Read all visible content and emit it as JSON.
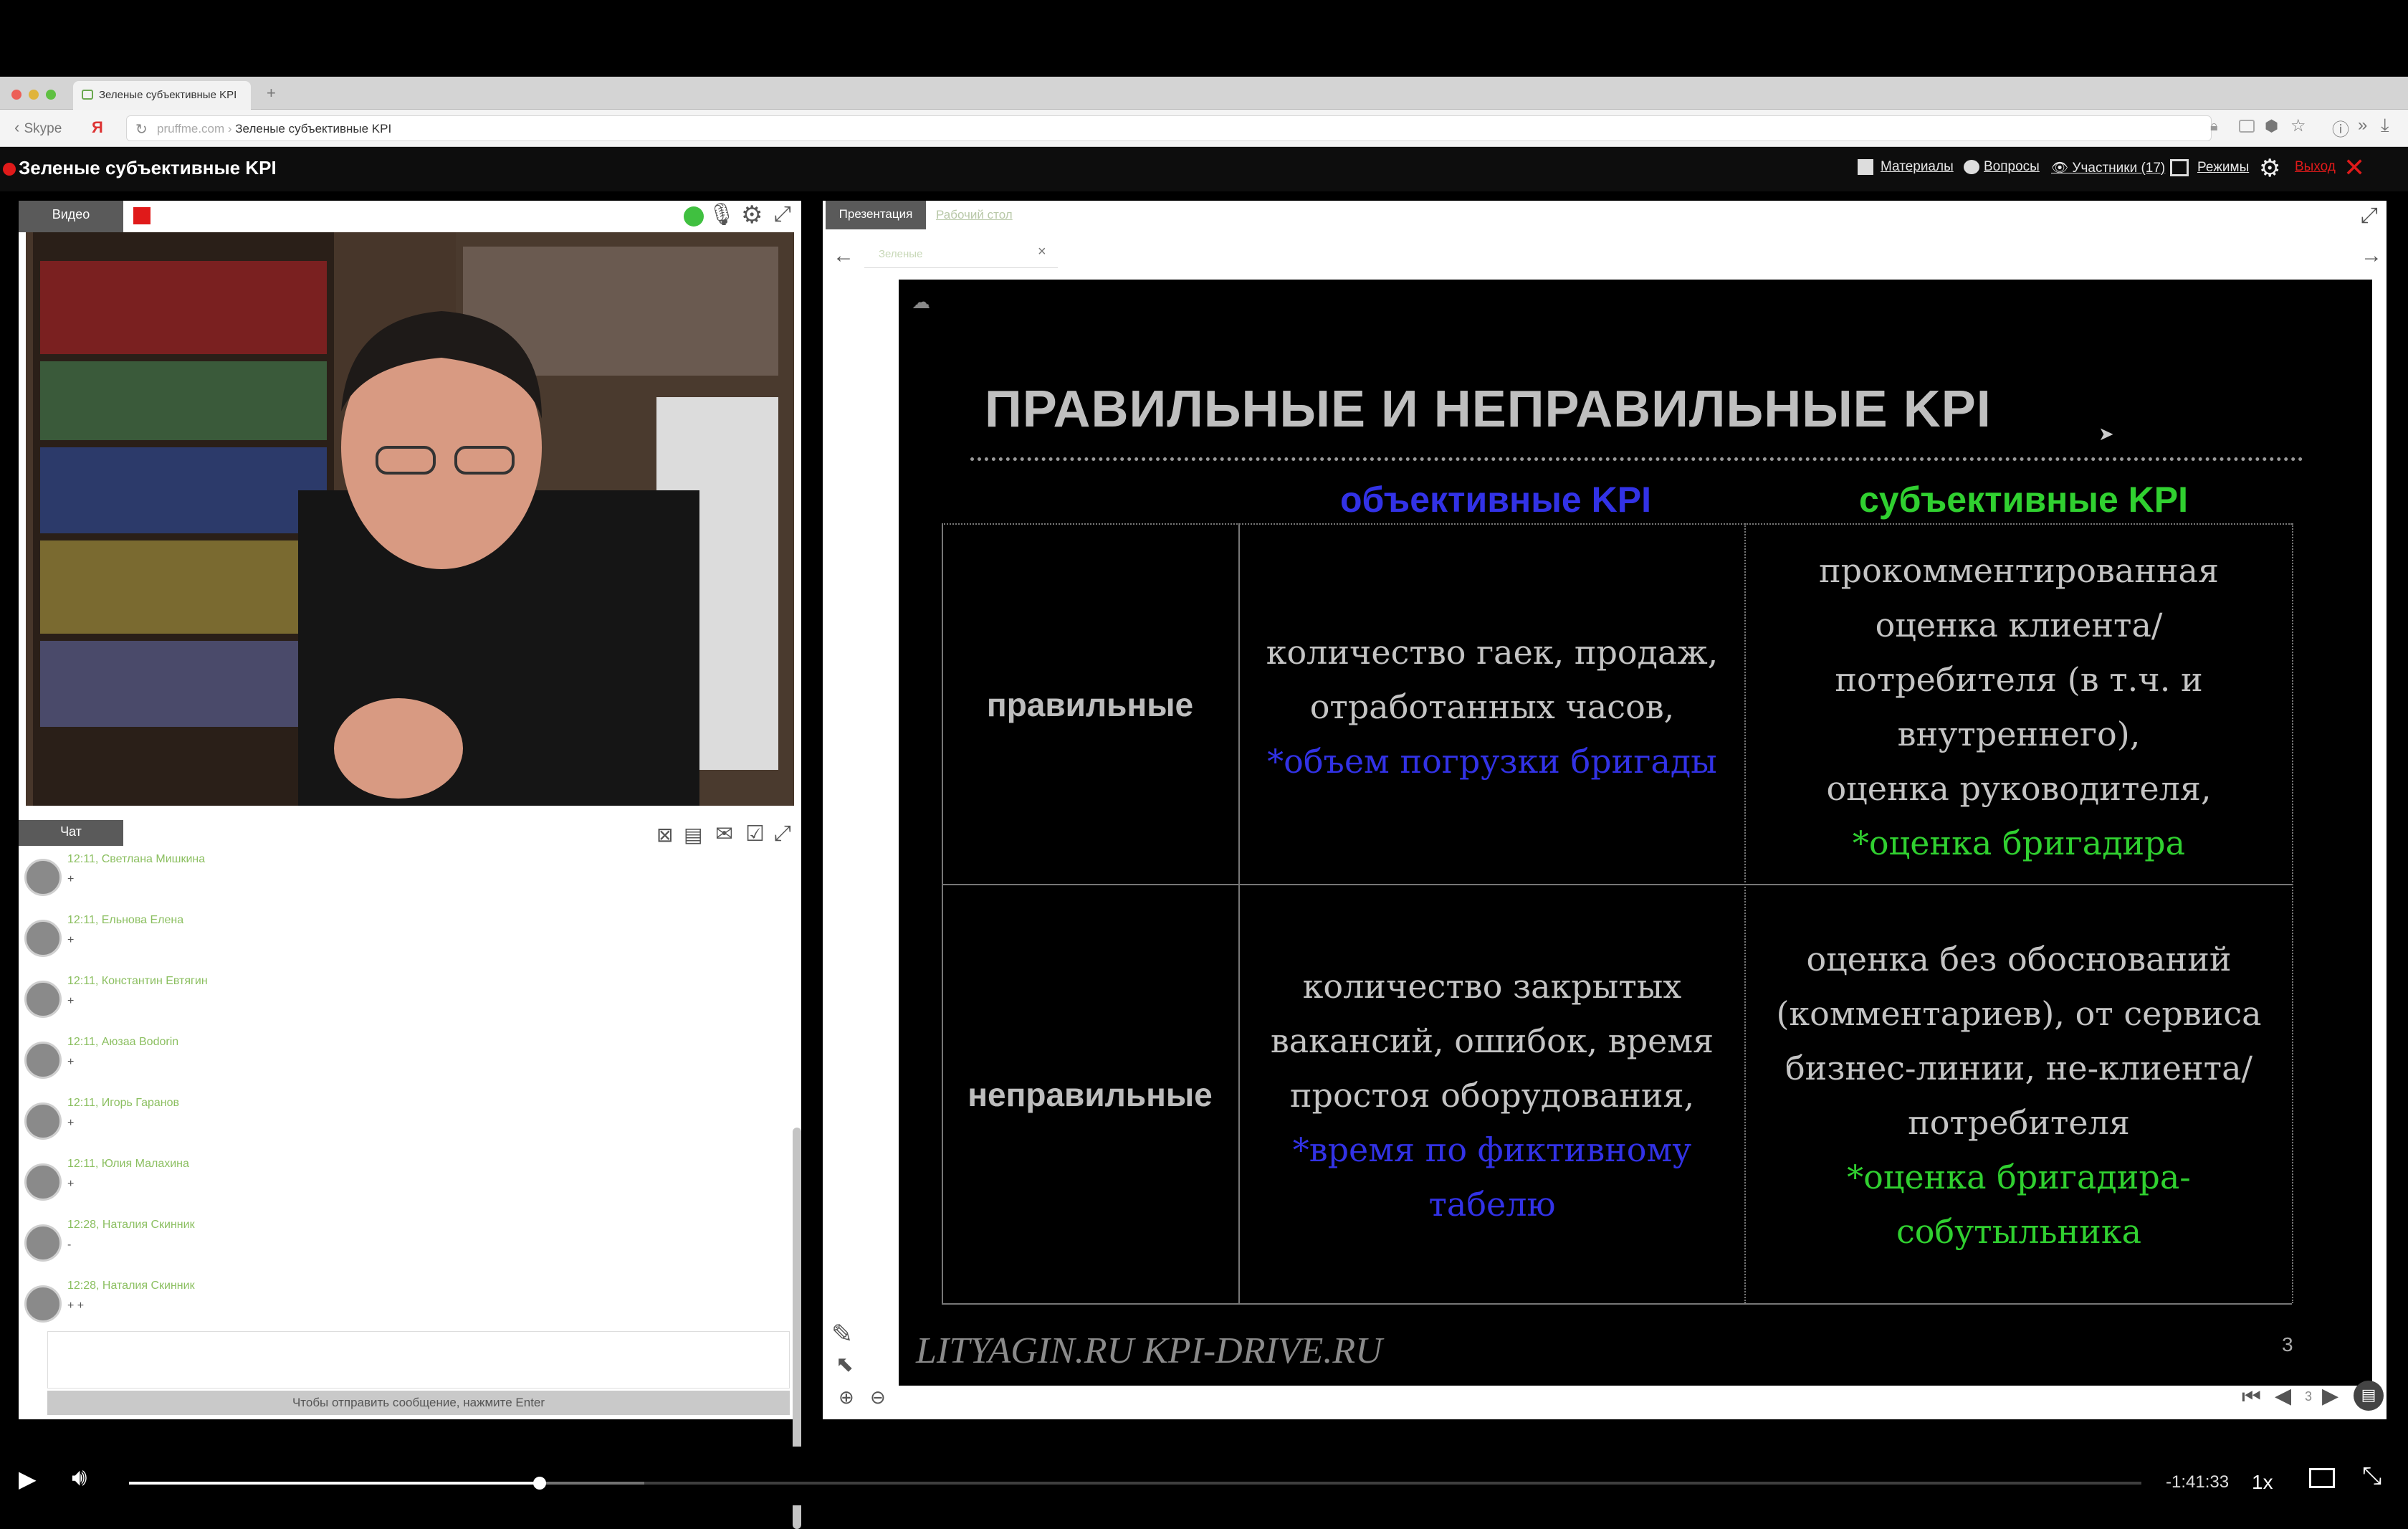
{
  "browser": {
    "tab_title": "Зеленые субъективные KPI",
    "back_label": "Skype",
    "url_domain": "pruffme.com",
    "url_separator": " › ",
    "url_page": "Зеленые субъективные KPI"
  },
  "app": {
    "title": "Зеленые субъективные KPI",
    "header": {
      "materials": "Материалы",
      "questions": "Вопросы",
      "participants": "Участники (17)",
      "modes": "Режимы",
      "exit": "Выход"
    }
  },
  "left_panel": {
    "video_tab": "Видео",
    "chat_tab": "Чат",
    "messages": [
      {
        "meta": "12:11, Светлана Мишкина",
        "text": "+"
      },
      {
        "meta": "12:11, Ельнова Елена",
        "text": "+"
      },
      {
        "meta": "12:11, Константин Евтягин",
        "text": "+"
      },
      {
        "meta": "12:11, Аюзаа Bodorin",
        "text": "+"
      },
      {
        "meta": "12:11, Игорь Гаранов",
        "text": "+"
      },
      {
        "meta": "12:11, Юлия Малахина",
        "text": "+"
      },
      {
        "meta": "12:28, Наталия Скинник",
        "text": "-"
      },
      {
        "meta": "12:28, Наталия Скинник",
        "text": "+ +"
      }
    ],
    "send_hint": "Чтобы отправить сообщение, нажмите Enter"
  },
  "right_panel": {
    "tabs": [
      "Презентация",
      "Рабочий стол"
    ],
    "doc_tab": "Зеленые",
    "slide": {
      "title": "ПРАВИЛЬНЫЕ И НЕПРАВИЛЬНЫЕ KPI",
      "col_objective": "объективные KPI",
      "col_subjective": "субъективные KPI",
      "row_correct": "правильные",
      "row_incorrect": "неправильные",
      "cells": {
        "correct_objective_lines": [
          "количество гаек, продаж,",
          "отработанных часов,"
        ],
        "correct_objective_note": "*объем погрузки бригады",
        "correct_subjective_lines": [
          "прокомментированная",
          "оценка клиента/",
          "потребителя (в т.ч. и",
          "внутреннего),",
          "оценка руководителя,"
        ],
        "correct_subjective_note": "*оценка бригадира",
        "incorrect_objective_lines": [
          "количество закрытых",
          "вакансий, ошибок, время",
          "простоя оборудования,"
        ],
        "incorrect_objective_note_lines": [
          "*время по фиктивному",
          "табелю"
        ],
        "incorrect_subjective_lines": [
          "оценка без обоснований",
          "(комментариев), от сервиса",
          "бизнес-линии, не-клиента/",
          "потребителя"
        ],
        "incorrect_subjective_note_lines": [
          "*оценка бригадира-",
          "собутыльника"
        ]
      },
      "footer": "LITYAGIN.RU  KPI-DRIVE.RU",
      "number": "3"
    },
    "slide_counter": "3"
  },
  "player": {
    "progress_fraction": 0.204,
    "buffer_fraction": 0.256,
    "time_remaining": "-1:41:33",
    "speed": "1x"
  },
  "colors": {
    "objective_blue": "#3232e6",
    "subjective_green": "#30d030",
    "record_red": "#e01a1a"
  }
}
